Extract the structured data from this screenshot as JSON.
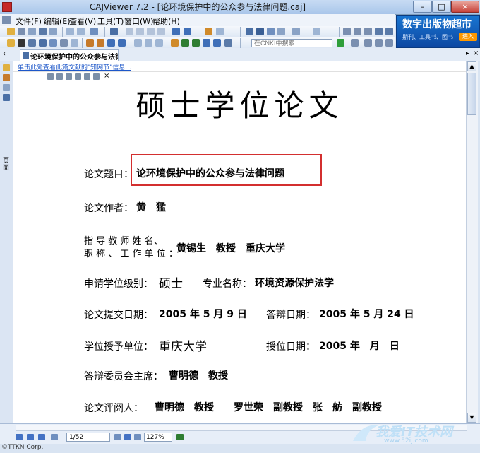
{
  "window": {
    "title": "CAJViewer 7.2 - [论环境保护中的公众参与法律问题.caj]",
    "minimize": "–",
    "maximize": "□",
    "close": "×"
  },
  "menu": [
    "文件(F)",
    "编辑(E)",
    "查看(V)",
    "工具(T)",
    "窗口(W)",
    "帮助(H)"
  ],
  "toolbar": {
    "cnki_search_placeholder": "在CNKI中搜索"
  },
  "ad": {
    "title": "数字出版物超市",
    "subtitle": "期刊、工具书、图书",
    "button": "进入"
  },
  "tab": {
    "label": "论环境保护中的公众参与法律..."
  },
  "side_panel": {
    "label": "页面"
  },
  "info_link": "单击此处查看此篇文献的\"知网节\"信息...",
  "document": {
    "heading": "硕士学位论文",
    "title_label": "论文题目：",
    "title_value": "论环境保护中的公众参与法律问题",
    "author_label": "论文作者：",
    "author_value": "黄　猛",
    "advisor_label_1": "指 导 教 师 姓 名、",
    "advisor_label_2": "职 称 、 工 作 单 位 ：",
    "advisor_value": "黄锡生　教授　重庆大学",
    "degree_label": "申请学位级别：",
    "degree_value": "硕士",
    "major_label": "专业名称：",
    "major_value": "环境资源保护法学",
    "submit_label": "论文提交日期：",
    "submit_value": "2005 年 5 月 9 日",
    "defense_label": "答辩日期：",
    "defense_value": "2005 年 5 月 24 日",
    "unit_label": "学位授予单位：",
    "unit_value": "重庆大学",
    "grant_label": "授位日期：",
    "grant_value": "2005 年　月　日",
    "chair_label": "答辩委员会主席：",
    "chair_value": "曹明德　教授",
    "reviewers_label": "论文评阅人：",
    "reviewers_value": "曹明德　教授　　罗世荣　副教授　张　舫　副教授"
  },
  "status": {
    "page": "1/52",
    "zoom": "127%",
    "copyright": "©TTKN Corp."
  },
  "watermark": {
    "text": "我爱IT技术网",
    "url": "www.52ij.com"
  },
  "colors": {
    "highlight_box": "#d32f2f",
    "ad_background": "#1565c0",
    "link": "#1d57c9"
  }
}
